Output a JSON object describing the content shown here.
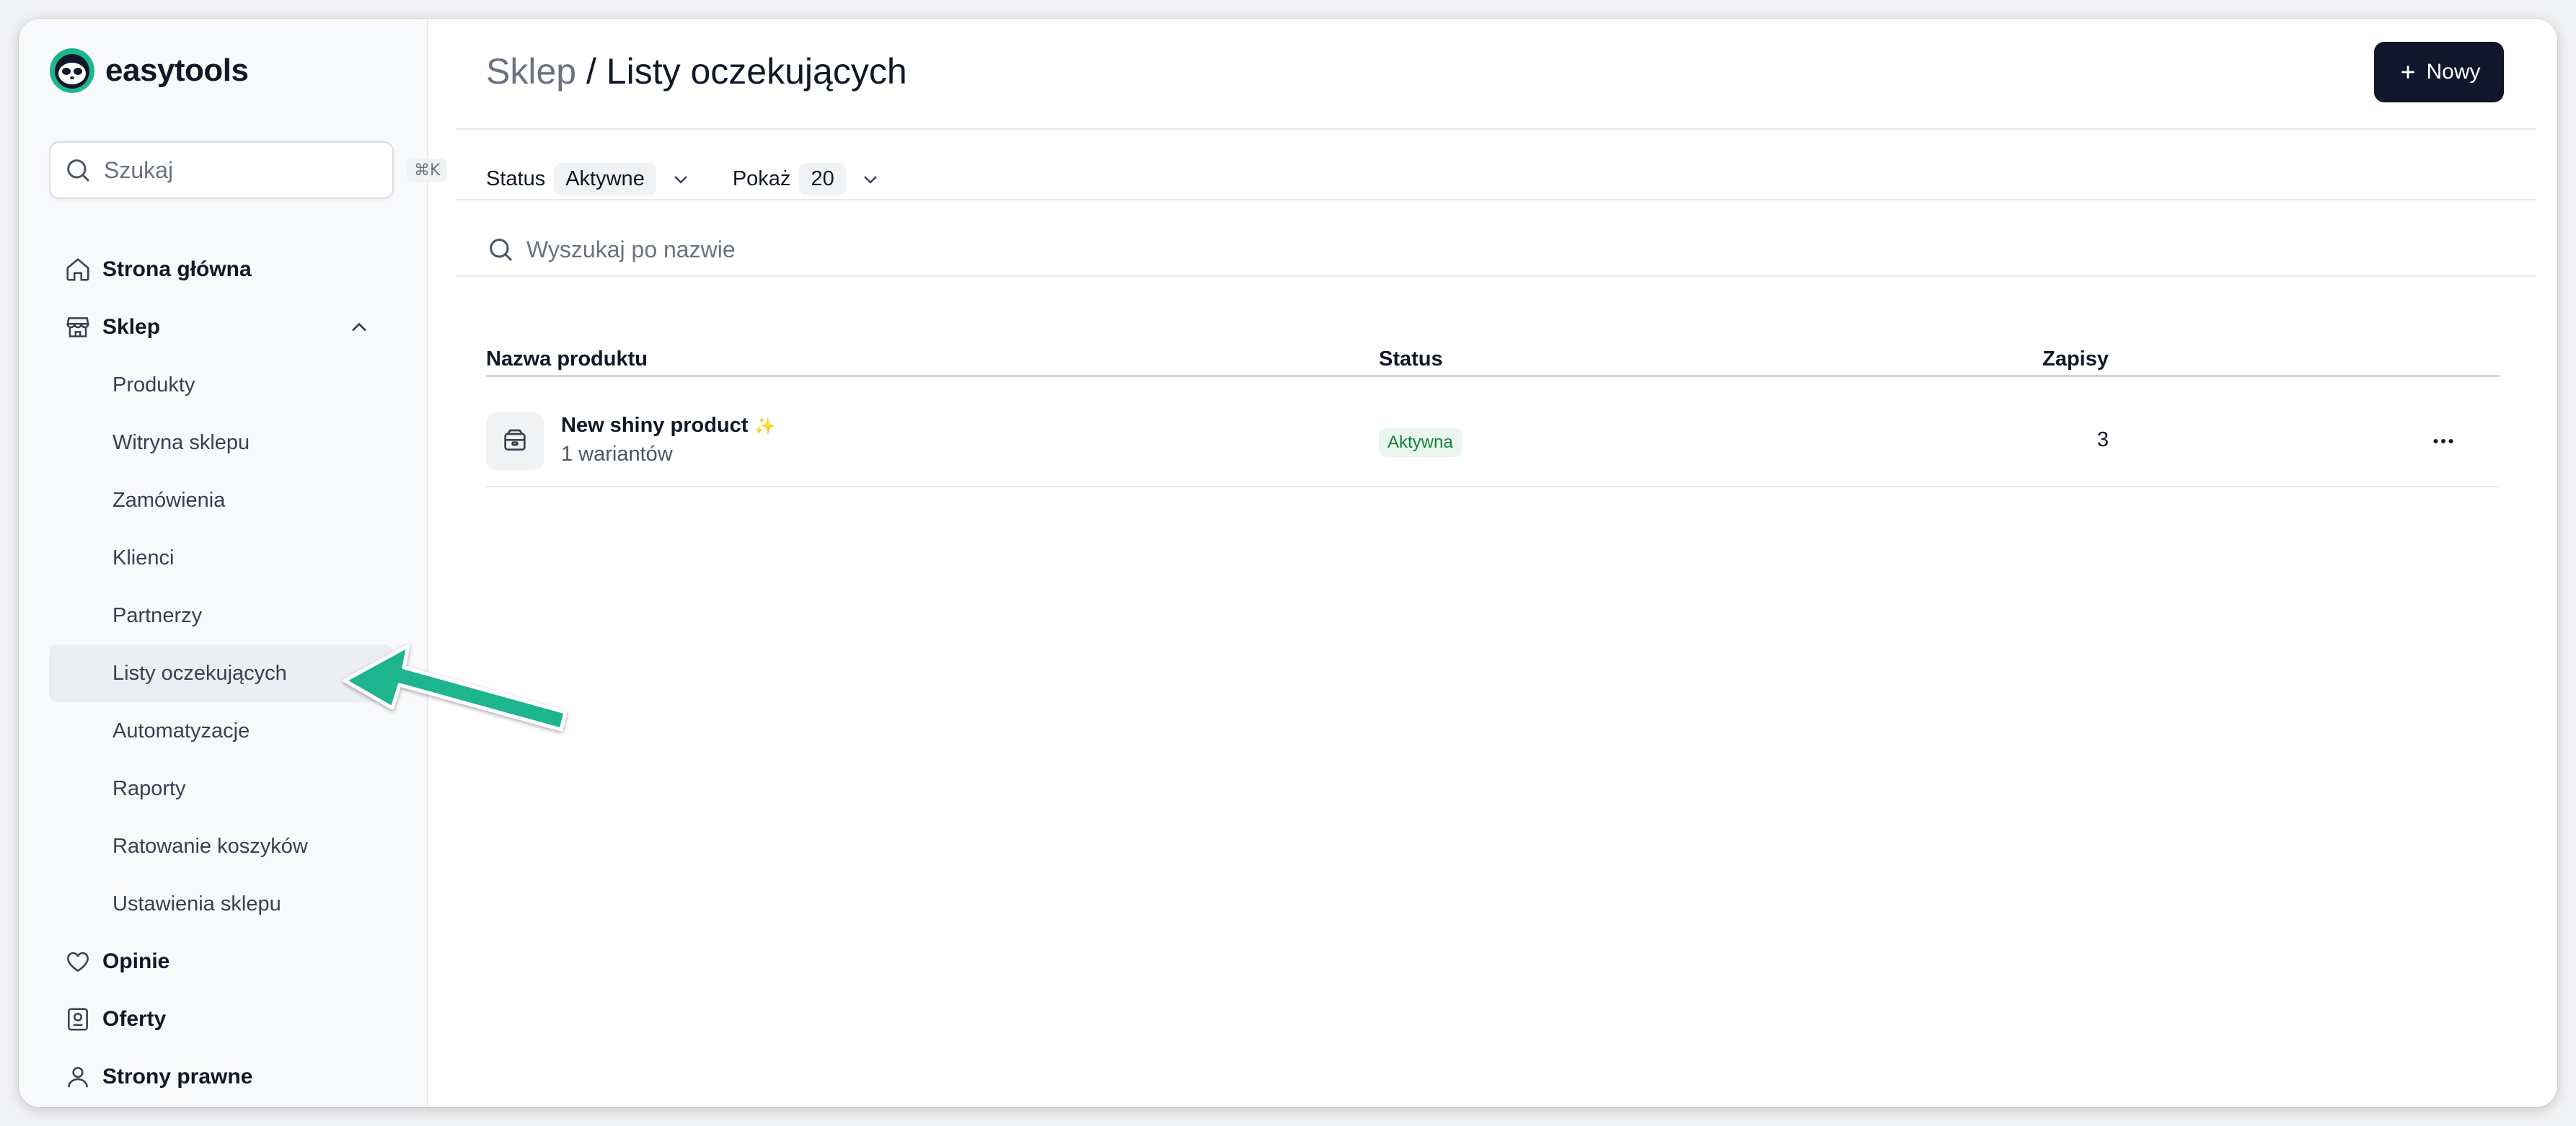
{
  "brand": {
    "name": "easytools"
  },
  "search": {
    "placeholder": "Szukaj",
    "shortcut": "⌘K"
  },
  "sidebar": {
    "items": [
      {
        "label": "Strona główna",
        "icon": "home-icon"
      },
      {
        "label": "Sklep",
        "icon": "store-icon"
      },
      {
        "label": "Produkty"
      },
      {
        "label": "Witryna sklepu"
      },
      {
        "label": "Zamówienia"
      },
      {
        "label": "Klienci"
      },
      {
        "label": "Partnerzy"
      },
      {
        "label": "Listy oczekujących"
      },
      {
        "label": "Automatyzacje"
      },
      {
        "label": "Raporty"
      },
      {
        "label": "Ratowanie koszyków"
      },
      {
        "label": "Ustawienia sklepu"
      },
      {
        "label": "Opinie",
        "icon": "heart-icon"
      },
      {
        "label": "Oferty",
        "icon": "offer-icon"
      },
      {
        "label": "Strony prawne",
        "icon": "user-icon"
      }
    ]
  },
  "header": {
    "breadcrumb": "Sklep",
    "separator": "/",
    "title": "Listy oczekujących",
    "new_button": "Nowy"
  },
  "filters": {
    "status_label": "Status",
    "status_value": "Aktywne",
    "show_label": "Pokaż",
    "show_value": "20"
  },
  "table_search": {
    "placeholder": "Wyszukaj po nazwie"
  },
  "table": {
    "columns": [
      "Nazwa produktu",
      "Status",
      "Zapisy"
    ],
    "rows": [
      {
        "name": "New shiny product",
        "emoji": "✨",
        "variants": "1 wariantów",
        "status": "Aktywna",
        "count": "3"
      }
    ]
  },
  "colors": {
    "accent": "#1fb58f",
    "dark_button": "#0f172a",
    "badge_bg": "#e9f7ee",
    "badge_text": "#15803d"
  }
}
